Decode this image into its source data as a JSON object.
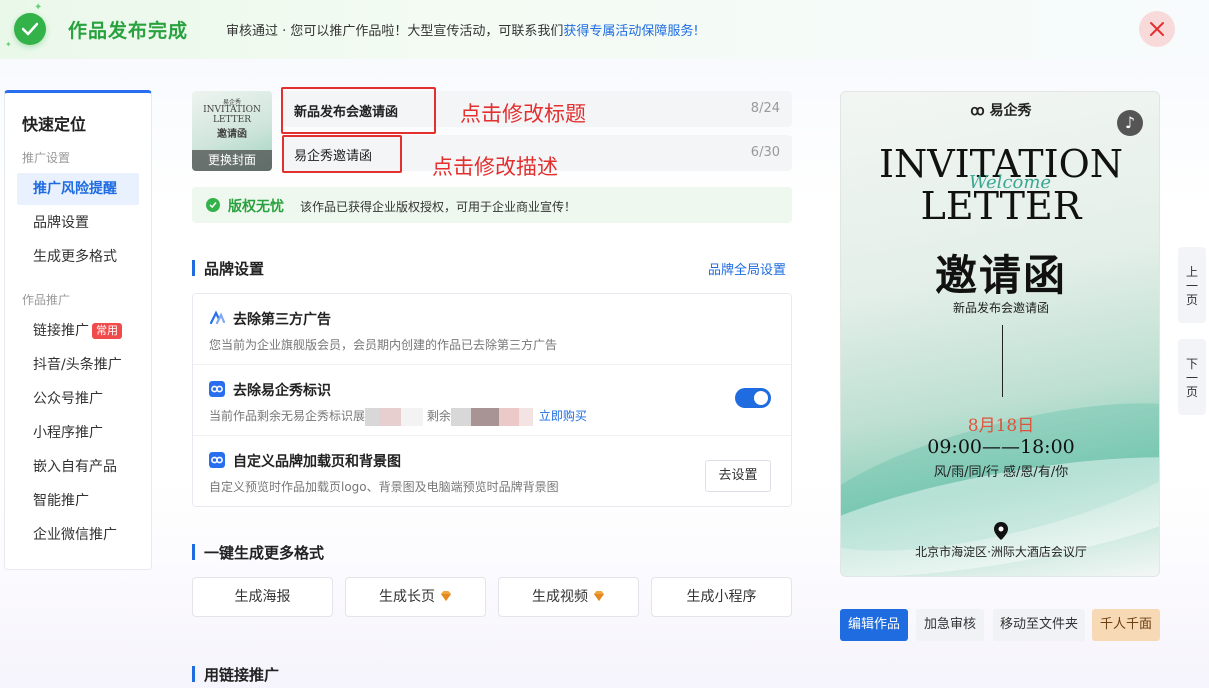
{
  "banner": {
    "title": "作品发布完成",
    "message": "审核通过 · 您可以推广作品啦！大型宣传活动，可联系我们",
    "message_link": "获得专属活动保障服务!"
  },
  "nav": {
    "title": "快速定位",
    "group1": "推广设置",
    "group2": "作品推广",
    "items": [
      {
        "label": "推广风险提醒"
      },
      {
        "label": "品牌设置"
      },
      {
        "label": "生成更多格式"
      },
      {
        "label": "链接推广",
        "badge": "常用"
      },
      {
        "label": "抖音/头条推广"
      },
      {
        "label": "公众号推广"
      },
      {
        "label": "小程序推广"
      },
      {
        "label": "嵌入自有产品"
      },
      {
        "label": "智能推广"
      },
      {
        "label": "企业微信推广"
      }
    ]
  },
  "cover": {
    "mini_title1": "INVITATION",
    "mini_title2": "LETTER",
    "mini_cn": "邀请函",
    "change_label": "更换封面"
  },
  "title_field": {
    "value": "新品发布会邀请函",
    "count": "8/24"
  },
  "desc_field": {
    "value": "易企秀邀请函",
    "count": "6/30"
  },
  "annotations": {
    "title_hint": "点击修改标题",
    "desc_hint": "点击修改描述"
  },
  "copyright": {
    "label": "版权无忧",
    "text": "该作品已获得企业版权授权，可用于企业商业宣传！"
  },
  "brand_section": {
    "title": "品牌设置",
    "global_link": "品牌全局设置",
    "rows": [
      {
        "title": "去除第三方广告",
        "desc": "您当前为企业旗舰版会员，会员期内创建的作品已去除第三方广告"
      },
      {
        "title": "去除易企秀标识",
        "desc_a": "当前作品剩余无易企秀标识展",
        "desc_b": "剩余",
        "buy_link": "立即购买"
      },
      {
        "title": "自定义品牌加载页和背景图",
        "desc": "自定义预览时作品加载页logo、背景图及电脑端预览时品牌背景图",
        "button": "去设置"
      }
    ]
  },
  "formats_section": {
    "title": "一键生成更多格式",
    "buttons": [
      "生成海报",
      "生成长页",
      "生成视频",
      "生成小程序"
    ]
  },
  "link_section": {
    "title": "用链接推广"
  },
  "preview": {
    "logo": "易企秀",
    "line1": "INVITATION",
    "welcome": "Welcome",
    "line2": "LETTER",
    "cn_title": "邀请函",
    "subtitle": "新品发布会邀请函",
    "date": "8月18日",
    "time": "09:00——18:00",
    "words": "风/雨/同/行  感/恩/有/你",
    "address": "北京市海淀区·洲际大酒店会议厅"
  },
  "pager": {
    "prev": [
      "上",
      "一",
      "页"
    ],
    "next": [
      "下",
      "一",
      "页"
    ]
  },
  "actions": [
    "编辑作品",
    "加急审核",
    "移动至文件夹",
    "千人千面"
  ],
  "colors": {
    "accent": "#1e6ce0",
    "success": "#2aa13f",
    "danger": "#e3302f",
    "vip": "#f7d9b5"
  }
}
